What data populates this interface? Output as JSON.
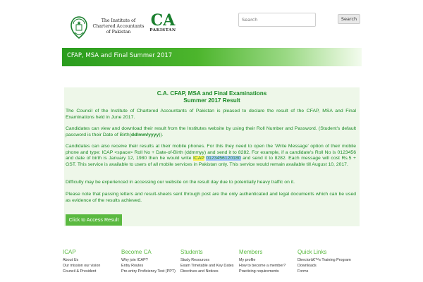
{
  "header": {
    "logo_text": [
      "The Institute of",
      "Chartered Accountants",
      "of Pakistan"
    ],
    "ca_logo_big": "CA",
    "ca_logo_small": "PAKISTAN",
    "search": {
      "placeholder": "Search",
      "button_label": "Search"
    }
  },
  "banner": {
    "title": "CFAP, MSA and Final Summer 2017"
  },
  "content": {
    "heading_line1": "C.A. CFAP, MSA and Final Examinations",
    "heading_line2": "Summer 2017 Result",
    "p1": "The Council of the Institute of Chartered Accountants of Pakistan is pleased to declare the result of the CFAP, MSA and Final Examinations held in June 2017.",
    "p2_a": "Candidates can view and download their result from the Institutes website by using their Roll Number and Password. (Student's default password is their Date of Birth(",
    "p2_bold": "dd/mm/yyyy",
    "p2_b": ")).",
    "p3_a": "Candidates can also receive their results at their mobile phones. For this they need to open the 'Write Message' option of their mobile phone and type: ICAP <space> Roll No + Date-of-Birth (ddmmyy) and send it to 8282. For example, if a candidate's Roll No is 0123456 and date of birth is January 12, 1980 then he would write ",
    "p3_hl1": "ICAP",
    "p3_hl2": "0123456120180",
    "p3_b": " and send it to 8282. Each message will cost Rs.5 + GST. This service is available to users of all mobile services in Pakistan only. This service would remain available till August 10, 2017.",
    "p4": "Difficulty may be experienced in accessing our website on the result day due to potentially heavy traffic on it.",
    "p5": "Please note that passing letters and result-sheets sent through post are the only authenticated and legal documents which can be used as evidence of the results achieved.",
    "access_button": "Click to Access Result"
  },
  "footer": {
    "columns": [
      {
        "heading": "ICAP",
        "links": [
          "About Us",
          "Our mission our vision",
          "Council & President"
        ]
      },
      {
        "heading": "Become CA",
        "links": [
          "Why join ICAP?",
          "Entry Routes",
          "Pre-entry Proficiency Test (PPT)"
        ]
      },
      {
        "heading": "Students",
        "links": [
          "Study Resources",
          "Exam Timetable and Key Dates",
          "Directives and Notices"
        ]
      },
      {
        "heading": "Members",
        "links": [
          "My profile",
          "How to become a member?",
          "Practicing requirements"
        ]
      },
      {
        "heading": "Quick Links",
        "links": [
          "Directorâ€™s Training Program",
          "Downloads",
          "Forms"
        ]
      }
    ]
  },
  "colors": {
    "brand_green": "#1b8a27",
    "accent_green": "#5ab940",
    "content_bg": "#eef7e9"
  }
}
